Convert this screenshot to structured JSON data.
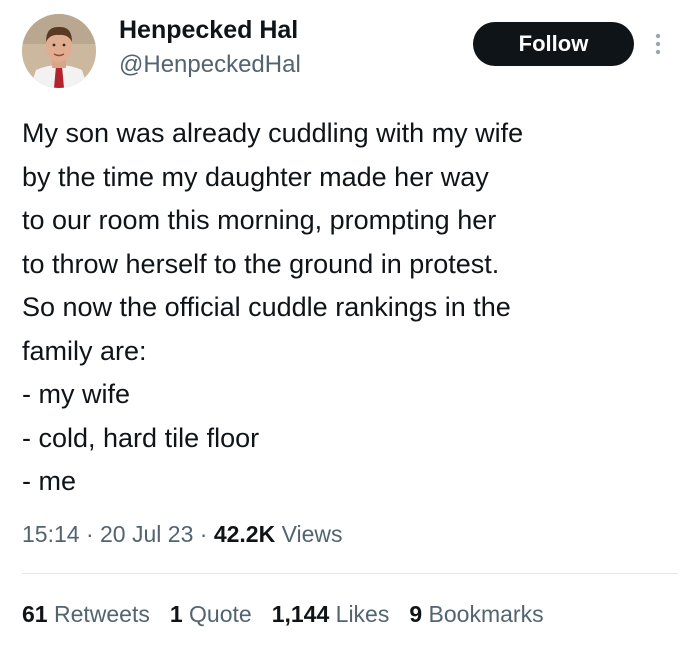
{
  "author": {
    "display_name": "Henpecked Hal",
    "handle": "@HenpeckedHal",
    "avatar_icon": "profile-photo"
  },
  "follow_label": "Follow",
  "more_icon": "vertical-ellipsis-icon",
  "tweet_lines": [
    "My son was already cuddling with my wife",
    "by the time my daughter made her way",
    "to our room this morning, prompting her",
    "to throw herself to the ground in protest.",
    "So now the official cuddle rankings in the",
    "family are:",
    "- my wife",
    "- cold, hard tile floor",
    "- me"
  ],
  "meta": {
    "time": "15:14",
    "sep1": " · ",
    "date": "20 Jul 23",
    "sep2": " · ",
    "views_count": "42.2K",
    "views_label": " Views"
  },
  "stats": {
    "retweets_count": "61",
    "retweets_label": " Retweets",
    "quotes_count": "1",
    "quotes_label": " Quote",
    "likes_count": "1,144",
    "likes_label": " Likes",
    "bookmarks_count": "9",
    "bookmarks_label": " Bookmarks"
  },
  "colors": {
    "text_primary": "#0f1419",
    "text_secondary": "#536471",
    "button_bg": "#0f1419",
    "button_text": "#ffffff",
    "divider": "#e4e8eb"
  }
}
